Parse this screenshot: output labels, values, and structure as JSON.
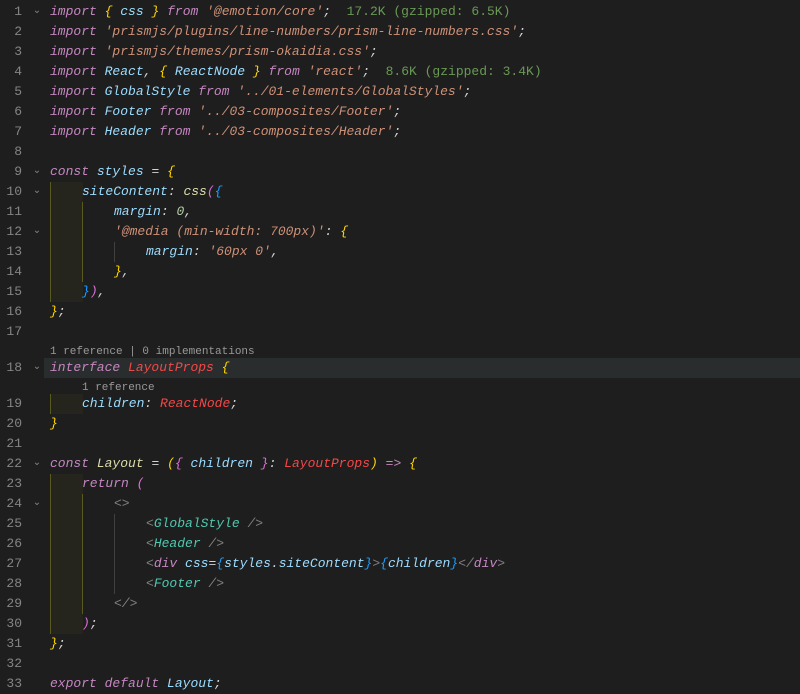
{
  "lines": {
    "l1": {
      "import": "import",
      "lb": "{",
      "css": "css",
      "rb": "}",
      "from": "from",
      "mod": "'@emotion/core'",
      "semi": ";",
      "hint": "17.2K (gzipped: 6.5K)"
    },
    "l2": {
      "import": "import",
      "mod": "'prismjs/plugins/line-numbers/prism-line-numbers.css'",
      "semi": ";"
    },
    "l3": {
      "import": "import",
      "mod": "'prismjs/themes/prism-okaidia.css'",
      "semi": ";"
    },
    "l4": {
      "import": "import",
      "react": "React",
      "comma": ",",
      "lb": "{",
      "rn": "ReactNode",
      "rb": "}",
      "from": "from",
      "mod": "'react'",
      "semi": ";",
      "hint": "8.6K (gzipped: 3.4K)"
    },
    "l5": {
      "import": "import",
      "gs": "GlobalStyle",
      "from": "from",
      "mod": "'../01-elements/GlobalStyles'",
      "semi": ";"
    },
    "l6": {
      "import": "import",
      "ft": "Footer",
      "from": "from",
      "mod": "'../03-composites/Footer'",
      "semi": ";"
    },
    "l7": {
      "import": "import",
      "hd": "Header",
      "from": "from",
      "mod": "'../03-composites/Header'",
      "semi": ";"
    },
    "l9": {
      "const": "const",
      "styles": "styles",
      "eq": "=",
      "lb": "{"
    },
    "l10": {
      "site": "siteContent",
      "colon": ":",
      "css": "css",
      "lp": "(",
      "lb": "{"
    },
    "l11": {
      "margin": "margin",
      "colon": ":",
      "zero": "0",
      "comma": ","
    },
    "l12": {
      "media": "'@media (min-width: 700px)'",
      "colon": ":",
      "lb": "{"
    },
    "l13": {
      "margin": "margin",
      "colon": ":",
      "val": "'60px 0'",
      "comma": ","
    },
    "l14": {
      "rb": "}",
      "comma": ","
    },
    "l15": {
      "rb": "}",
      "rp": ")",
      "comma": ","
    },
    "l16": {
      "rb": "}",
      "semi": ";"
    },
    "cl1": "1 reference | 0 implementations",
    "l18": {
      "interface": "interface",
      "lp": "LayoutProps",
      "lb": "{"
    },
    "cl2": "1 reference",
    "l19": {
      "children": "children",
      "colon": ":",
      "rn": "ReactNode",
      "semi": ";"
    },
    "l20": {
      "rb": "}"
    },
    "l22": {
      "const": "const",
      "layout": "Layout",
      "eq": "=",
      "lp": "(",
      "lb": "{",
      "children": "children",
      "rb": "}",
      "colon": ":",
      "type": "LayoutProps",
      "rp": ")",
      "arrow": "=>",
      "lb2": "{"
    },
    "l23": {
      "return": "return",
      "lp": "("
    },
    "l24": {
      "frag": "<>"
    },
    "l25": {
      "open": "<",
      "tag": "GlobalStyle",
      "close": " />"
    },
    "l26": {
      "open": "<",
      "tag": "Header",
      "close": " />"
    },
    "l27": {
      "open": "<",
      "tag": "div",
      "attr": "css",
      "eq": "=",
      "lb": "{",
      "styles": "styles",
      "dot": ".",
      "site": "siteContent",
      "rb": "}",
      "gt": ">",
      "lbe": "{",
      "children": "children",
      "rbe": "}",
      "copen": "</",
      "ctag": "div",
      "cgt": ">"
    },
    "l28": {
      "open": "<",
      "tag": "Footer",
      "close": " />"
    },
    "l29": {
      "frag": "</>"
    },
    "l30": {
      "rp": ")",
      "semi": ";"
    },
    "l31": {
      "rb": "}",
      "semi": ";"
    },
    "l33": {
      "export": "export",
      "default": "default",
      "layout": "Layout",
      "semi": ";"
    }
  },
  "numbers": [
    "1",
    "2",
    "3",
    "4",
    "5",
    "6",
    "7",
    "8",
    "9",
    "10",
    "11",
    "12",
    "13",
    "14",
    "15",
    "16",
    "17",
    "18",
    "19",
    "20",
    "21",
    "22",
    "23",
    "24",
    "25",
    "26",
    "27",
    "28",
    "29",
    "30",
    "31",
    "32",
    "33"
  ],
  "fold": {
    "down": "⌄"
  }
}
